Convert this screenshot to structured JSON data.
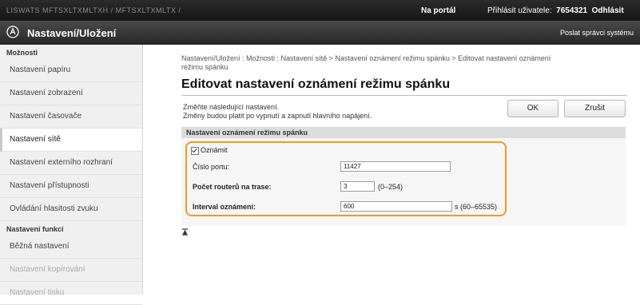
{
  "topbar": {
    "crumbs": "LISWATS     MFTSXLTXMLTXH / MFTSXLTXMLTX /",
    "portal_link": "Na portál",
    "user_label": "Přihlásit uživatele:",
    "user_id": "7654321",
    "logout": "Odhlásit"
  },
  "header": {
    "title": "Nastavení/Uložení",
    "mail_link": "Poslat správci systému"
  },
  "sidebar": {
    "section_options": "Možnosti",
    "items": [
      {
        "label": "Nastavení papíru"
      },
      {
        "label": "Nastavení zobrazení"
      },
      {
        "label": "Nastavení časovače"
      },
      {
        "label": "Nastavení sítě"
      },
      {
        "label": "Nastavení externího rozhraní"
      },
      {
        "label": "Nastavení přístupnosti"
      },
      {
        "label": "Ovládání hlasitosti zvuku"
      }
    ],
    "section_functions": "Nastavení funkcí",
    "func_items": [
      {
        "label": "Běžná nastavení"
      },
      {
        "label": "Nastavení kopírování"
      },
      {
        "label": "Nastavení tisku"
      }
    ]
  },
  "main": {
    "breadcrumb_line1": "Nastavení/Uložení : Možnosti : Nastavení sítě > Nastavení oznámení režimu spánku > Editovat nastavení oznámení",
    "breadcrumb_line2": "režimu spánku",
    "title": "Editovat nastavení oznámení režimu spánku",
    "desc_line1": "Změňte následující nastavení.",
    "desc_line2": "Změny budou platit po vypnutí a zapnutí hlavního napájení.",
    "ok_label": "OK",
    "cancel_label": "Zrušit",
    "section_title": "Nastavení oznámení režimu spánku",
    "notify_label": "Oznámit",
    "port_label": "Číslo portu:",
    "port_value": "11427",
    "routers_label": "Počet routerů na trase:",
    "routers_value": "3",
    "routers_range": "(0–254)",
    "interval_label": "Interval oznámení:",
    "interval_value": "600",
    "interval_range": "s (60–65535)"
  }
}
